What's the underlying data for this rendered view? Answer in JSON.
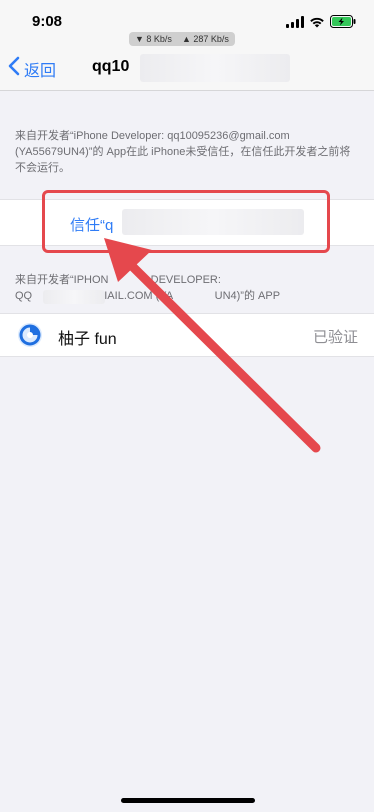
{
  "status_bar": {
    "time": "9:08",
    "download_speed": "▼ 8 Kb/s",
    "upload_speed": "▲ 287 Kb/s",
    "icons": [
      "signal-icon",
      "wifi-icon",
      "battery-charging-icon"
    ],
    "battery_color": "#34c759"
  },
  "nav": {
    "back_label": "返回",
    "title": "qq10"
  },
  "trust_section": {
    "note": "来自开发者“iPhone Developer: qq10095236@gmail.com (YA55679UN4)”的 App在此 iPhone未受信任，在信任此开发者之前将不会运行。",
    "trust_button_label": "信任“q"
  },
  "apps_section": {
    "note_line1": "来自开发者“IPHON",
    "note_line1_tail": "DEVELOPER:",
    "note_line2_head": "QQ",
    "note_line2_mid": "IAIL.COM (YA",
    "note_line2_tail": "UN4)”的 APP",
    "apps": [
      {
        "name": "柚子 fun",
        "status": "已验证",
        "icon": "yuzu-app-icon"
      }
    ]
  },
  "colors": {
    "accent": "#2f7cf6",
    "annotation_red": "#e5484d",
    "background": "#f2f2f7"
  }
}
